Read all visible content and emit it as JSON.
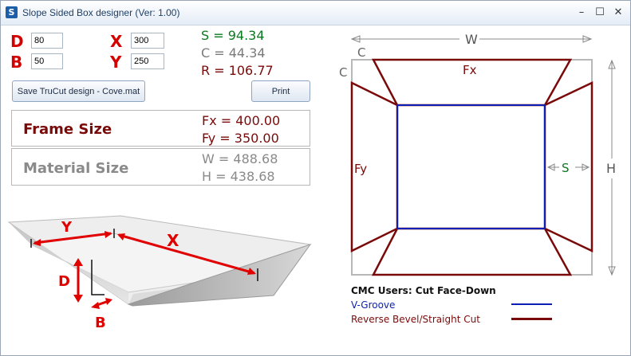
{
  "window": {
    "title": "Slope Sided Box designer (Ver: 1.00)",
    "icon_letter": "S",
    "controls": {
      "minimize": "–",
      "maximize": "☐",
      "close": "✕"
    }
  },
  "inputs": {
    "d": {
      "label": "D",
      "value": "80"
    },
    "b": {
      "label": "B",
      "value": "50"
    },
    "x": {
      "label": "X",
      "value": "300"
    },
    "y": {
      "label": "Y",
      "value": "250"
    }
  },
  "results": {
    "s": "S = 94.34",
    "c": "C = 44.34",
    "r": "R = 106.77"
  },
  "buttons": {
    "save": "Save TruCut design - Cove.mat",
    "print": "Print"
  },
  "frame_size": {
    "label": "Frame Size",
    "fx": "Fx = 400.00",
    "fy": "Fy = 350.00"
  },
  "material_size": {
    "label": "Material Size",
    "w": "W = 488.68",
    "h": "H = 438.68"
  },
  "box_diagram": {
    "y": "Y",
    "x": "X",
    "d": "D",
    "b": "B"
  },
  "layout_diagram": {
    "w": "W",
    "h": "H",
    "c_top": "C",
    "c_left": "C",
    "fx": "Fx",
    "fy": "Fy",
    "s": "S"
  },
  "legend": {
    "title": "CMC Users: Cut Face-Down",
    "vgroove": "V-Groove",
    "bevel": "Reverse Bevel/Straight Cut"
  },
  "colors": {
    "red": "#d40000",
    "green": "#0a7a1f",
    "gray": "#7a7a7a",
    "maroon": "#7a0a0a",
    "blue": "#0b1fb4"
  }
}
